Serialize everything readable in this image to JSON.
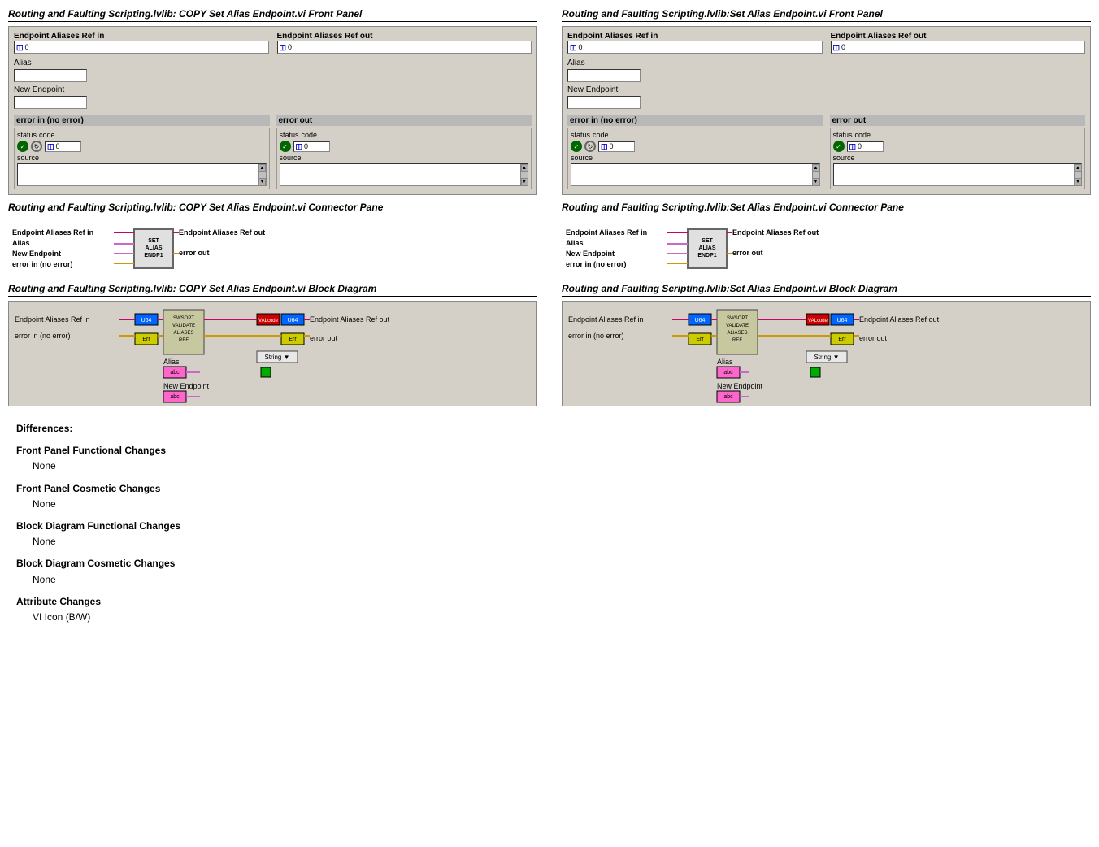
{
  "left_front_panel": {
    "title": "Routing and Faulting Scripting.lvlib:  COPY  Set Alias Endpoint.vi Front Panel",
    "ref_in_label": "Endpoint Aliases Ref in",
    "ref_out_label": "Endpoint Aliases Ref out",
    "ref_in_value": "0",
    "ref_out_value": "0",
    "alias_label": "Alias",
    "new_endpoint_label": "New Endpoint",
    "error_in_label": "error in (no error)",
    "error_out_label": "error out",
    "status_label": "status",
    "code_label": "code",
    "source_label": "source",
    "status_value": "",
    "code_value": "0",
    "code_value2": "0"
  },
  "right_front_panel": {
    "title": "Routing and Faulting Scripting.lvlib:Set Alias Endpoint.vi Front Panel",
    "ref_in_label": "Endpoint Aliases Ref in",
    "ref_out_label": "Endpoint Aliases Ref out",
    "ref_in_value": "0",
    "ref_out_value": "0",
    "alias_label": "Alias",
    "new_endpoint_label": "New Endpoint",
    "error_in_label": "error in (no error)",
    "error_out_label": "error out",
    "status_label": "status",
    "code_label": "code",
    "source_label": "source"
  },
  "left_connector": {
    "title": "Routing and Faulting Scripting.lvlib:  COPY  Set Alias Endpoint.vi Connector Pane",
    "ref_in": "Endpoint Aliases Ref in",
    "alias": "Alias",
    "new_endpoint": "New Endpoint",
    "error_in": "error in (no error)",
    "ref_out": "Endpoint Aliases Ref out",
    "error_out": "error out",
    "center_text": "SET\nALIAS\nENDP1"
  },
  "right_connector": {
    "title": "Routing and Faulting Scripting.lvlib:Set Alias Endpoint.vi Connector Pane",
    "ref_in": "Endpoint Aliases Ref in",
    "alias": "Alias",
    "new_endpoint": "New Endpoint",
    "error_in": "error in (no error)",
    "ref_out": "Endpoint Aliases Ref out",
    "error_out": "error out",
    "center_text": "SET\nALIAS\nENDP1"
  },
  "left_block_diagram": {
    "title": "Routing and Faulting Scripting.lvlib:  COPY  Set Alias Endpoint.vi Block Diagram",
    "ref_in_label": "Endpoint Aliases Ref in",
    "ref_out_label": "Endpoint Aliases Ref out",
    "error_in_label": "error in (no error)",
    "error_out_label": "error out",
    "alias_label": "Alias",
    "new_endpoint_label": "New Endpoint",
    "string_label": "String ▼"
  },
  "right_block_diagram": {
    "title": "Routing and Faulting Scripting.lvlib:Set Alias Endpoint.vi Block Diagram",
    "ref_in_label": "Endpoint Aliases Ref in",
    "ref_out_label": "Endpoint Aliases Ref out",
    "error_in_label": "error in (no error)",
    "error_out_label": "error out",
    "alias_label": "Alias",
    "new_endpoint_label": "New Endpoint",
    "string_label": "String ▼"
  },
  "differences": {
    "title": "Differences:",
    "categories": [
      {
        "name": "Front Panel Functional Changes",
        "value": "None"
      },
      {
        "name": "Front Panel Cosmetic Changes",
        "value": "None"
      },
      {
        "name": "Block Diagram Functional Changes",
        "value": "None"
      },
      {
        "name": "Block Diagram Cosmetic Changes",
        "value": "None"
      },
      {
        "name": "Attribute Changes",
        "value": "VI Icon (B/W)"
      }
    ]
  }
}
